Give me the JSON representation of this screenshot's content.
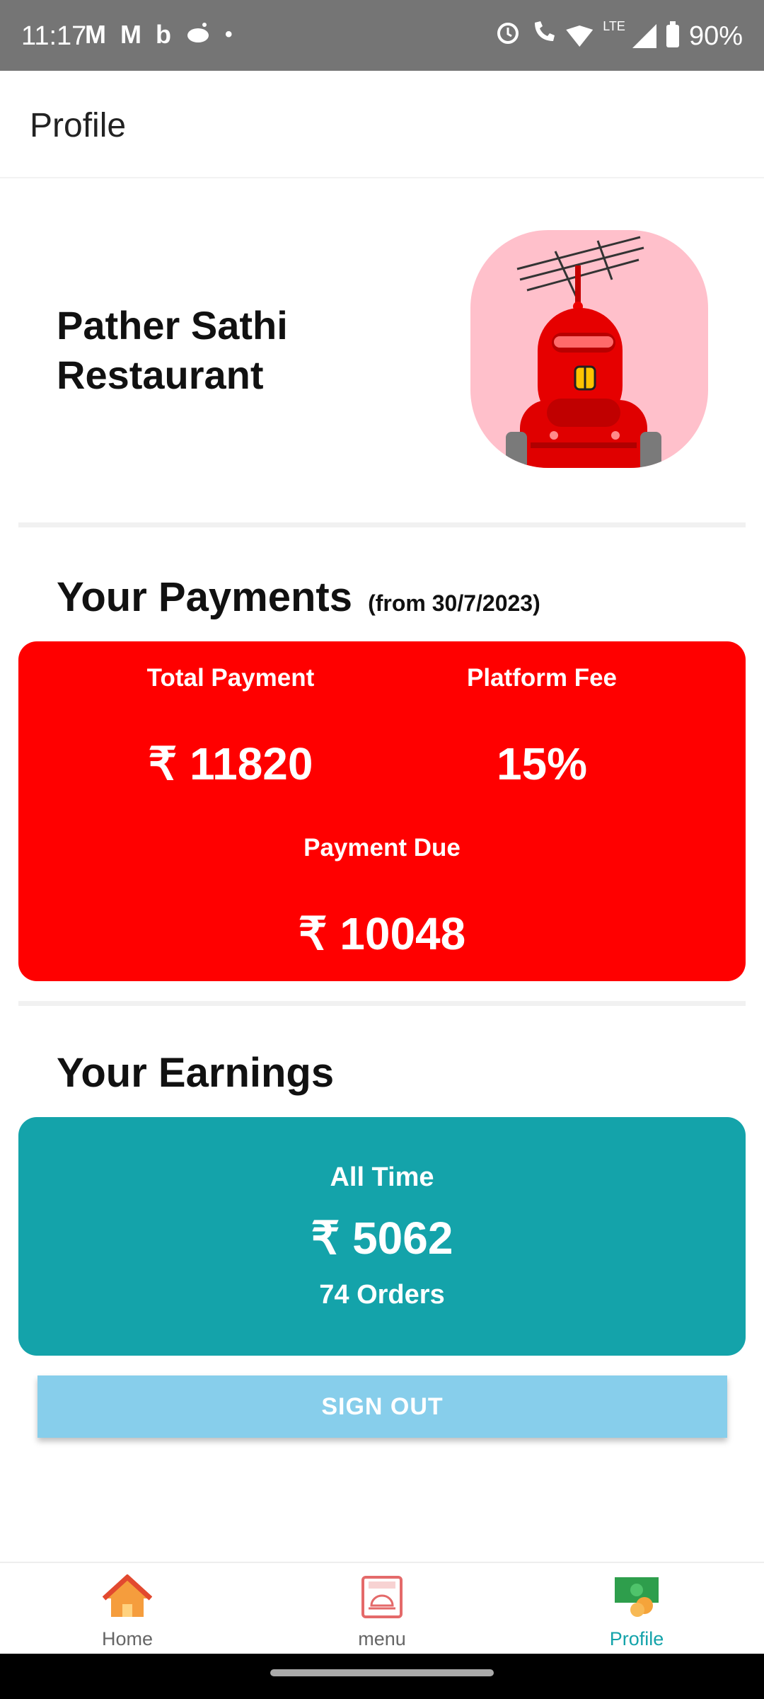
{
  "status_bar": {
    "time": "11:17",
    "left_icons": [
      "M",
      "M",
      "b"
    ],
    "battery": "90%",
    "network": "LTE"
  },
  "app_bar": {
    "title": "Profile"
  },
  "profile": {
    "restaurant_name": "Pather Sathi Restaurant"
  },
  "payments": {
    "title": "Your Payments",
    "subtitle": "(from 30/7/2023)",
    "total_label": "Total Payment",
    "total_value": "₹ 11820",
    "fee_label": "Platform Fee",
    "fee_value": "15%",
    "due_label": "Payment Due",
    "due_value": "₹ 10048",
    "card_color": "#ff0000"
  },
  "earnings": {
    "title": "Your Earnings",
    "period": "All Time",
    "amount": "₹ 5062",
    "orders": "74 Orders",
    "card_color": "#14a3aa"
  },
  "actions": {
    "sign_out": "SIGN OUT"
  },
  "bottom_nav": {
    "items": [
      {
        "label": "Home",
        "icon": "home-icon"
      },
      {
        "label": "menu",
        "icon": "menu-card-icon"
      },
      {
        "label": "Profile",
        "icon": "profile-money-icon",
        "active": true
      }
    ],
    "active_color": "#14a3aa"
  }
}
